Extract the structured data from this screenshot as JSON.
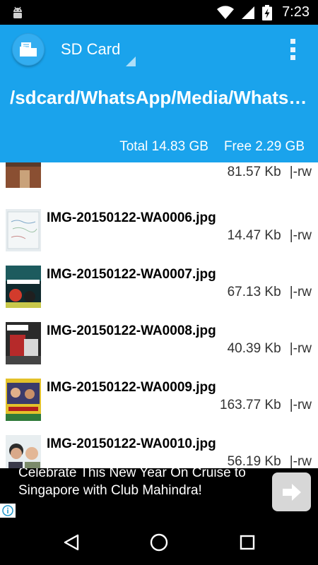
{
  "status_bar": {
    "time": "7:23",
    "icons": [
      "android-icon",
      "wifi-icon",
      "signal-icon",
      "battery-charging-icon"
    ]
  },
  "header": {
    "app_icon": "folder-icon",
    "storage_name": "SD Card",
    "path": "/sdcard/WhatsApp/Media/WhatsApp Images",
    "total": "Total 14.83 GB",
    "free": "Free 2.29 GB",
    "menu_icon": "overflow-menu-icon",
    "color": "#1aa3ec"
  },
  "files": [
    {
      "name": "",
      "size": "81.57 Kb",
      "perm": "|-rw"
    },
    {
      "name": "IMG-20150122-WA0006.jpg",
      "size": "14.47 Kb",
      "perm": "|-rw"
    },
    {
      "name": "IMG-20150122-WA0007.jpg",
      "size": "67.13 Kb",
      "perm": "|-rw"
    },
    {
      "name": "IMG-20150122-WA0008.jpg",
      "size": "40.39 Kb",
      "perm": "|-rw"
    },
    {
      "name": "IMG-20150122-WA0009.jpg",
      "size": "163.77 Kb",
      "perm": "|-rw"
    },
    {
      "name": "IMG-20150122-WA0010.jpg",
      "size": "56.19 Kb",
      "perm": "|-rw"
    }
  ],
  "ad": {
    "text": "Celebrate This New Year On Cruise to Singapore with Club Mahindra!",
    "info_icon": "info-icon",
    "button_icon": "arrow-right-icon"
  },
  "nav": {
    "back": "back-icon",
    "home": "home-icon",
    "recents": "recents-icon"
  }
}
